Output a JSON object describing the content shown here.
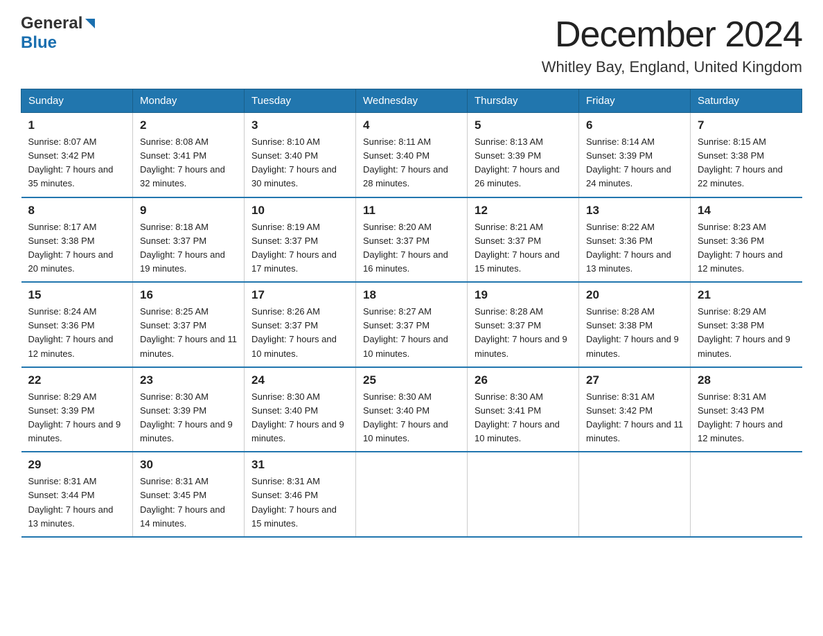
{
  "header": {
    "logo_general": "General",
    "logo_blue": "Blue",
    "main_title": "December 2024",
    "subtitle": "Whitley Bay, England, United Kingdom"
  },
  "calendar": {
    "days_of_week": [
      "Sunday",
      "Monday",
      "Tuesday",
      "Wednesday",
      "Thursday",
      "Friday",
      "Saturday"
    ],
    "weeks": [
      [
        {
          "day": "1",
          "sunrise": "8:07 AM",
          "sunset": "3:42 PM",
          "daylight": "7 hours and 35 minutes."
        },
        {
          "day": "2",
          "sunrise": "8:08 AM",
          "sunset": "3:41 PM",
          "daylight": "7 hours and 32 minutes."
        },
        {
          "day": "3",
          "sunrise": "8:10 AM",
          "sunset": "3:40 PM",
          "daylight": "7 hours and 30 minutes."
        },
        {
          "day": "4",
          "sunrise": "8:11 AM",
          "sunset": "3:40 PM",
          "daylight": "7 hours and 28 minutes."
        },
        {
          "day": "5",
          "sunrise": "8:13 AM",
          "sunset": "3:39 PM",
          "daylight": "7 hours and 26 minutes."
        },
        {
          "day": "6",
          "sunrise": "8:14 AM",
          "sunset": "3:39 PM",
          "daylight": "7 hours and 24 minutes."
        },
        {
          "day": "7",
          "sunrise": "8:15 AM",
          "sunset": "3:38 PM",
          "daylight": "7 hours and 22 minutes."
        }
      ],
      [
        {
          "day": "8",
          "sunrise": "8:17 AM",
          "sunset": "3:38 PM",
          "daylight": "7 hours and 20 minutes."
        },
        {
          "day": "9",
          "sunrise": "8:18 AM",
          "sunset": "3:37 PM",
          "daylight": "7 hours and 19 minutes."
        },
        {
          "day": "10",
          "sunrise": "8:19 AM",
          "sunset": "3:37 PM",
          "daylight": "7 hours and 17 minutes."
        },
        {
          "day": "11",
          "sunrise": "8:20 AM",
          "sunset": "3:37 PM",
          "daylight": "7 hours and 16 minutes."
        },
        {
          "day": "12",
          "sunrise": "8:21 AM",
          "sunset": "3:37 PM",
          "daylight": "7 hours and 15 minutes."
        },
        {
          "day": "13",
          "sunrise": "8:22 AM",
          "sunset": "3:36 PM",
          "daylight": "7 hours and 13 minutes."
        },
        {
          "day": "14",
          "sunrise": "8:23 AM",
          "sunset": "3:36 PM",
          "daylight": "7 hours and 12 minutes."
        }
      ],
      [
        {
          "day": "15",
          "sunrise": "8:24 AM",
          "sunset": "3:36 PM",
          "daylight": "7 hours and 12 minutes."
        },
        {
          "day": "16",
          "sunrise": "8:25 AM",
          "sunset": "3:37 PM",
          "daylight": "7 hours and 11 minutes."
        },
        {
          "day": "17",
          "sunrise": "8:26 AM",
          "sunset": "3:37 PM",
          "daylight": "7 hours and 10 minutes."
        },
        {
          "day": "18",
          "sunrise": "8:27 AM",
          "sunset": "3:37 PM",
          "daylight": "7 hours and 10 minutes."
        },
        {
          "day": "19",
          "sunrise": "8:28 AM",
          "sunset": "3:37 PM",
          "daylight": "7 hours and 9 minutes."
        },
        {
          "day": "20",
          "sunrise": "8:28 AM",
          "sunset": "3:38 PM",
          "daylight": "7 hours and 9 minutes."
        },
        {
          "day": "21",
          "sunrise": "8:29 AM",
          "sunset": "3:38 PM",
          "daylight": "7 hours and 9 minutes."
        }
      ],
      [
        {
          "day": "22",
          "sunrise": "8:29 AM",
          "sunset": "3:39 PM",
          "daylight": "7 hours and 9 minutes."
        },
        {
          "day": "23",
          "sunrise": "8:30 AM",
          "sunset": "3:39 PM",
          "daylight": "7 hours and 9 minutes."
        },
        {
          "day": "24",
          "sunrise": "8:30 AM",
          "sunset": "3:40 PM",
          "daylight": "7 hours and 9 minutes."
        },
        {
          "day": "25",
          "sunrise": "8:30 AM",
          "sunset": "3:40 PM",
          "daylight": "7 hours and 10 minutes."
        },
        {
          "day": "26",
          "sunrise": "8:30 AM",
          "sunset": "3:41 PM",
          "daylight": "7 hours and 10 minutes."
        },
        {
          "day": "27",
          "sunrise": "8:31 AM",
          "sunset": "3:42 PM",
          "daylight": "7 hours and 11 minutes."
        },
        {
          "day": "28",
          "sunrise": "8:31 AM",
          "sunset": "3:43 PM",
          "daylight": "7 hours and 12 minutes."
        }
      ],
      [
        {
          "day": "29",
          "sunrise": "8:31 AM",
          "sunset": "3:44 PM",
          "daylight": "7 hours and 13 minutes."
        },
        {
          "day": "30",
          "sunrise": "8:31 AM",
          "sunset": "3:45 PM",
          "daylight": "7 hours and 14 minutes."
        },
        {
          "day": "31",
          "sunrise": "8:31 AM",
          "sunset": "3:46 PM",
          "daylight": "7 hours and 15 minutes."
        },
        null,
        null,
        null,
        null
      ]
    ]
  }
}
